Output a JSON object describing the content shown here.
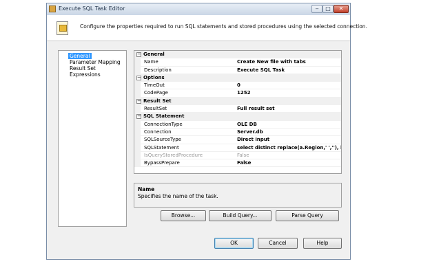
{
  "window": {
    "title": "Execute SQL Task Editor"
  },
  "caption_buttons": {
    "minimize": "‒",
    "maximize": "□",
    "close": "✕"
  },
  "header": {
    "text": "Configure the properties required to run SQL statements and stored procedures using the selected connection."
  },
  "nav": {
    "items": [
      "General",
      "Parameter Mapping",
      "Result Set",
      "Expressions"
    ],
    "selected": "General"
  },
  "grid": {
    "expander_glyph": "−",
    "categories": [
      {
        "label": "General",
        "props": [
          {
            "name": "Name",
            "value": "Create New file with tabs"
          },
          {
            "name": "Description",
            "value": "Execute SQL Task"
          }
        ]
      },
      {
        "label": "Options",
        "props": [
          {
            "name": "TimeOut",
            "value": "0"
          },
          {
            "name": "CodePage",
            "value": "1252"
          }
        ]
      },
      {
        "label": "Result Set",
        "props": [
          {
            "name": "ResultSet",
            "value": "Full result set"
          }
        ]
      },
      {
        "label": "SQL Statement",
        "props": [
          {
            "name": "ConnectionType",
            "value": "OLE DB"
          },
          {
            "name": "Connection",
            "value": "Server.db"
          },
          {
            "name": "SQLSourceType",
            "value": "Direct input"
          },
          {
            "name": "SQLStatement",
            "value": "select distinct replace(a.Region,' ',''), b.Subsidi..."
          },
          {
            "name": "IsQueryStoredProcedure",
            "value": "False"
          },
          {
            "name": "BypassPrepare",
            "value": "False"
          }
        ]
      }
    ]
  },
  "description": {
    "title": "Name",
    "text": "Specifies the name of the task."
  },
  "buttons": {
    "browse": "Browse...",
    "build_query": "Build Query...",
    "parse_query": "Parse Query",
    "ok": "OK",
    "cancel": "Cancel",
    "help": "Help"
  },
  "colors": {
    "selection": "#3399ff",
    "window_bg": "#f0f0f0",
    "titlebar": "#c9d6e6"
  }
}
